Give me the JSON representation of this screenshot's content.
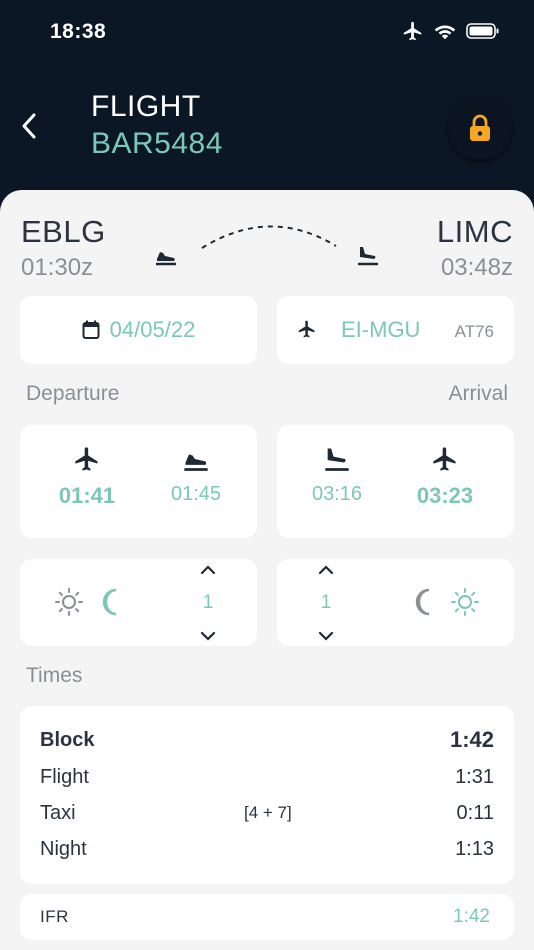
{
  "status_bar": {
    "time": "18:38",
    "icons": [
      "airplane-mode-icon",
      "wifi-icon",
      "battery-icon"
    ]
  },
  "header": {
    "title": "FLIGHT",
    "flight_number": "BAR5484",
    "lock_icon": "lock-icon"
  },
  "route": {
    "departure": {
      "code": "EBLG",
      "time": "01:30z"
    },
    "arrival": {
      "code": "LIMC",
      "time": "03:48z"
    }
  },
  "flight_info": {
    "date": "04/05/22",
    "registration": "EI-MGU",
    "aircraft_type": "AT76"
  },
  "departure": {
    "label": "Departure",
    "offblock": "01:41",
    "takeoff": "01:45"
  },
  "arrival": {
    "label": "Arrival",
    "landing": "03:16",
    "onblock": "03:23"
  },
  "night": {
    "departure_value": "1",
    "arrival_value": "1"
  },
  "times": {
    "label": "Times",
    "rows": [
      {
        "name": "Block",
        "value": "1:42",
        "note": ""
      },
      {
        "name": "Flight",
        "value": "1:31",
        "note": ""
      },
      {
        "name": "Taxi",
        "value": "0:11",
        "note": "[4 + 7]"
      },
      {
        "name": "Night",
        "value": "1:13",
        "note": ""
      }
    ]
  },
  "ifr": {
    "label": "IFR",
    "value": "1:42"
  },
  "colors": {
    "accent": "#7cc7b8",
    "header_bg": "#0c1726",
    "lock": "#f5a623",
    "text": "#2b3340",
    "muted": "#8a8f96"
  }
}
